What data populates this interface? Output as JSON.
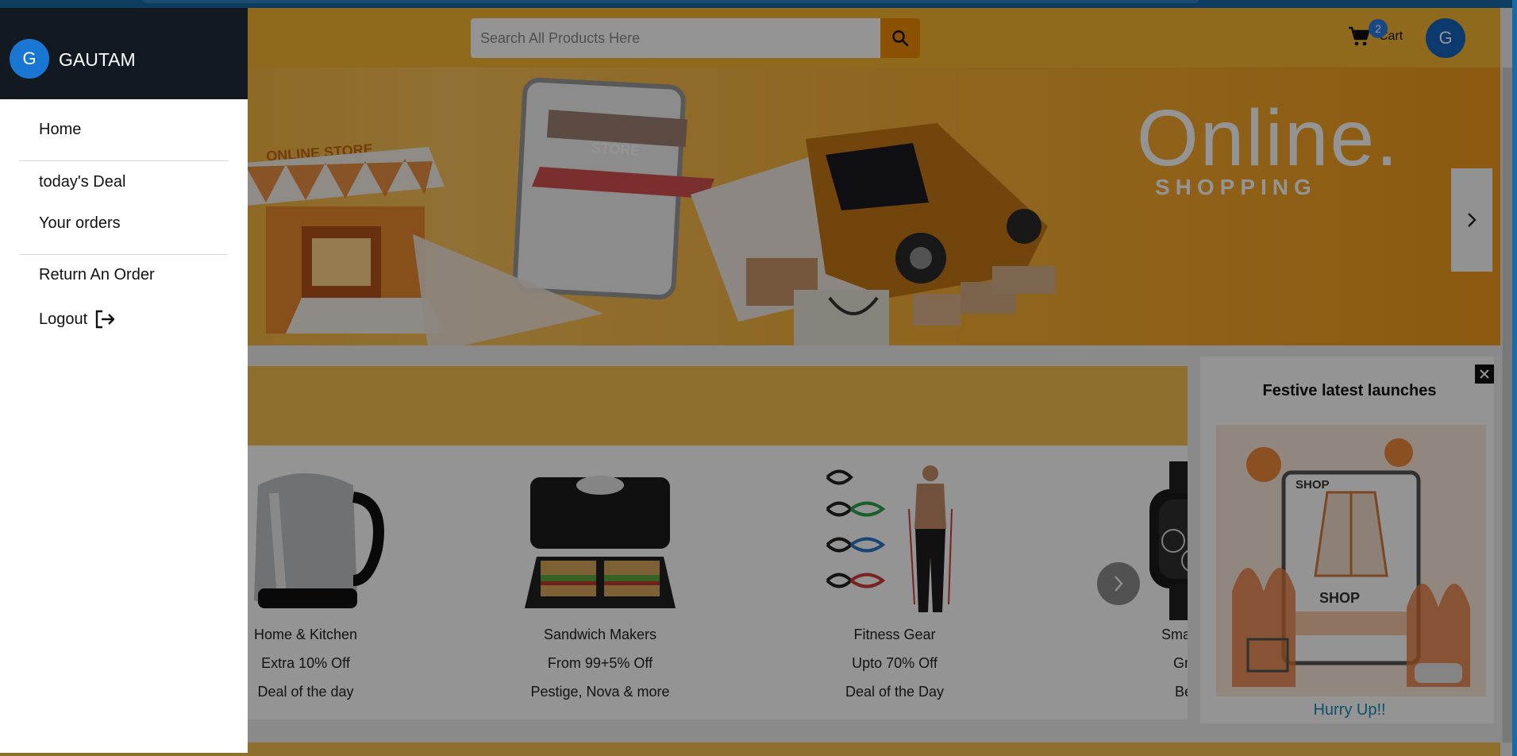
{
  "header": {
    "search_placeholder": "Search All Products Here",
    "cart_count": "2",
    "cart_label": "Cart",
    "avatar_initial": "G"
  },
  "banner": {
    "headline": "Online.",
    "subheadline": "SHOPPING",
    "store_sign": "ONLINE STORE",
    "phone_sign": "STORE"
  },
  "deals": {
    "items": [
      {
        "name": "Home & Kitchen",
        "offer": "Extra 10% Off",
        "note": "Deal of the day"
      },
      {
        "name": "Sandwich Makers",
        "offer": "From 99+5% Off",
        "note": "Pestige, Nova & more"
      },
      {
        "name": "Fitness Gear",
        "offer": "Upto 70% Off",
        "note": "Deal of the Day"
      },
      {
        "name": "Smart W",
        "offer": "Grab",
        "note": "Best"
      }
    ]
  },
  "festive": {
    "title": "Festive latest launches",
    "cta": "Hurry Up!!",
    "sign_top": "SHOP",
    "sign_bottom": "SHOP"
  },
  "drawer": {
    "user_initial": "G",
    "user_name": "GAUTAM",
    "items": [
      {
        "label": "Home"
      },
      {
        "label": "today's Deal"
      },
      {
        "label": "Your orders"
      },
      {
        "label": "Return An Order"
      },
      {
        "label": "Logout"
      }
    ]
  },
  "colors": {
    "header_bg": "#f7b733",
    "search_button": "#f08c00",
    "drawer_head": "#131921",
    "avatar": "#1565c0",
    "link": "#1a8bb8"
  }
}
